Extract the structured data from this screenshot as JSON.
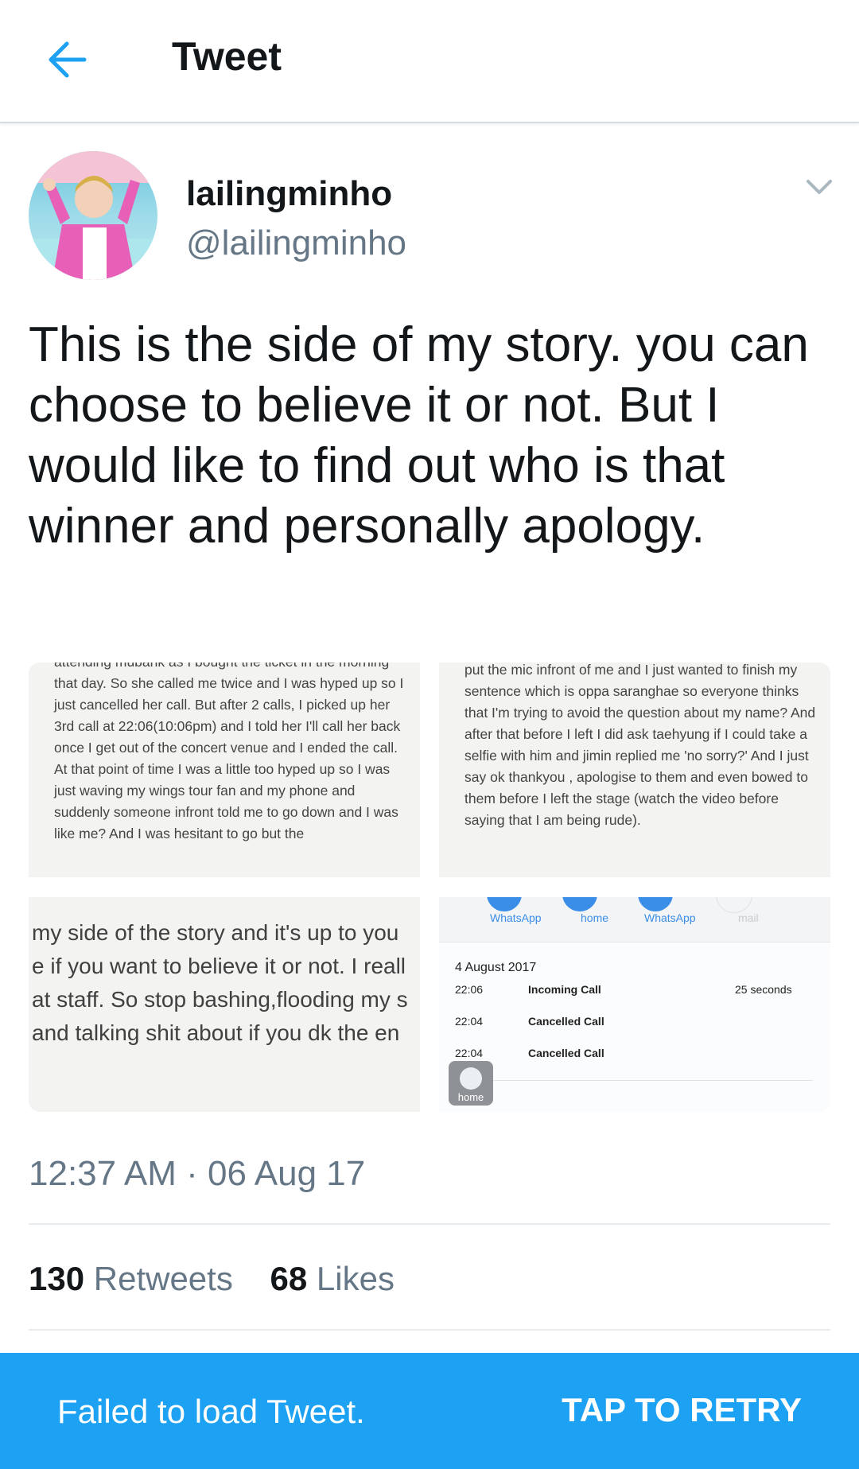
{
  "header": {
    "title": "Tweet",
    "back_icon": "arrow-left-icon"
  },
  "author": {
    "name": "lailingminho",
    "handle": "@lailingminho"
  },
  "tweet": {
    "text": "This is the side of my story. you can choose to believe it or not. But I would like to find out who is that winner and personally apology.",
    "timestamp": "12:37 AM · 06 Aug 17"
  },
  "media": {
    "img1_text": "attending mubank as I bought the ticket in the morning that day. So she called me twice and I was hyped up so I just cancelled her call. But after 2 calls, I picked up her 3rd call at 22:06(10:06pm) and I told her I'll call her back once I get out of the concert venue and I ended the call. At that point of time I was a little too hyped up so I was just waving my wings tour fan and my phone and suddenly someone infront told me to go down and I was like me? And I was hesitant to go but the",
    "img2_text": "put the mic infront of me and I just wanted to finish my sentence which is oppa saranghae so everyone thinks that I'm trying to avoid the question about my name? And after that before I left I did ask taehyung if I could take a selfie with him and jimin replied me 'no sorry?' And I just say ok thankyou , apologise to them and even bowed to them before I left the stage (watch the video before saying that I am being rude).",
    "img3_lines": [
      "my side of the story and it's up to you",
      "e if you want to believe it or not. I reall",
      "at staff. So stop bashing,flooding my s",
      "and talking shit about if you dk the en"
    ],
    "img4": {
      "buttons": [
        "WhatsApp",
        "home",
        "WhatsApp",
        "mail"
      ],
      "date": "4 August 2017",
      "rows": [
        {
          "time": "22:06",
          "kind": "Incoming Call",
          "duration": "25 seconds"
        },
        {
          "time": "22:04",
          "kind": "Cancelled Call",
          "duration": ""
        },
        {
          "time": "22:04",
          "kind": "Cancelled Call",
          "duration": ""
        }
      ],
      "home_label": "home"
    }
  },
  "stats": {
    "retweets_count": "130",
    "retweets_label": "Retweets",
    "likes_count": "68",
    "likes_label": "Likes"
  },
  "banner": {
    "message": "Failed to load Tweet.",
    "action": "TAP TO RETRY"
  },
  "colors": {
    "accent": "#1da1f2",
    "secondary_text": "#657786",
    "primary_text": "#14171a"
  }
}
